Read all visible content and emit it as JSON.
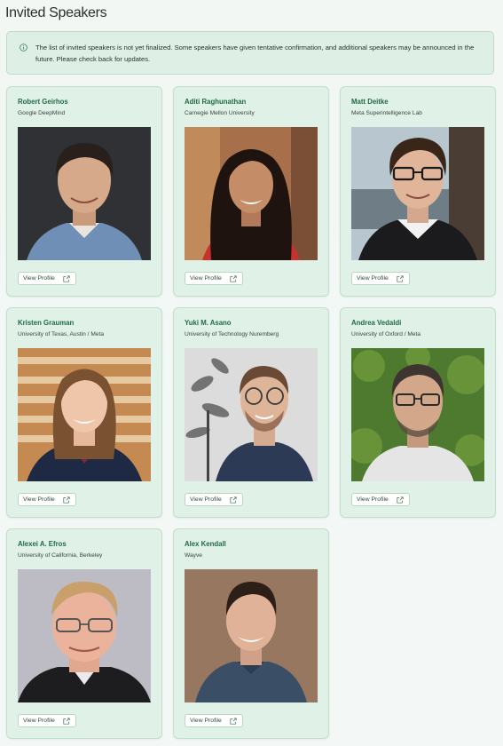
{
  "page": {
    "title": "Invited Speakers"
  },
  "notice": {
    "icon": "info-icon",
    "text": "The list of invited speakers is not yet finalized. Some speakers have given tentative confirmation, and additional speakers may be announced in the future. Please check back for updates."
  },
  "speakers": [
    {
      "name": "Robert Geirhos",
      "affiliation": "Google DeepMind",
      "button": "View Profile"
    },
    {
      "name": "Aditi Raghunathan",
      "affiliation": "Carnegie Mellon University",
      "button": "View Profile"
    },
    {
      "name": "Matt Deitke",
      "affiliation": "Meta Superintelligence Lab",
      "button": "View Profile"
    },
    {
      "name": "Kristen Grauman",
      "affiliation": "University of Texas, Austin / Meta",
      "button": "View Profile"
    },
    {
      "name": "Yuki M. Asano",
      "affiliation": "University of Technology Nuremberg",
      "button": "View Profile"
    },
    {
      "name": "Andrea Vedaldi",
      "affiliation": "University of Oxford / Meta",
      "button": "View Profile"
    },
    {
      "name": "Alexei A. Efros",
      "affiliation": "University of California, Berkeley",
      "button": "View Profile"
    },
    {
      "name": "Alex Kendall",
      "affiliation": "Wayve",
      "button": "View Profile"
    }
  ],
  "colors": {
    "accent": "#1f6b46",
    "card_bg": "#e0f1e7",
    "notice_bg": "#def0e6"
  }
}
